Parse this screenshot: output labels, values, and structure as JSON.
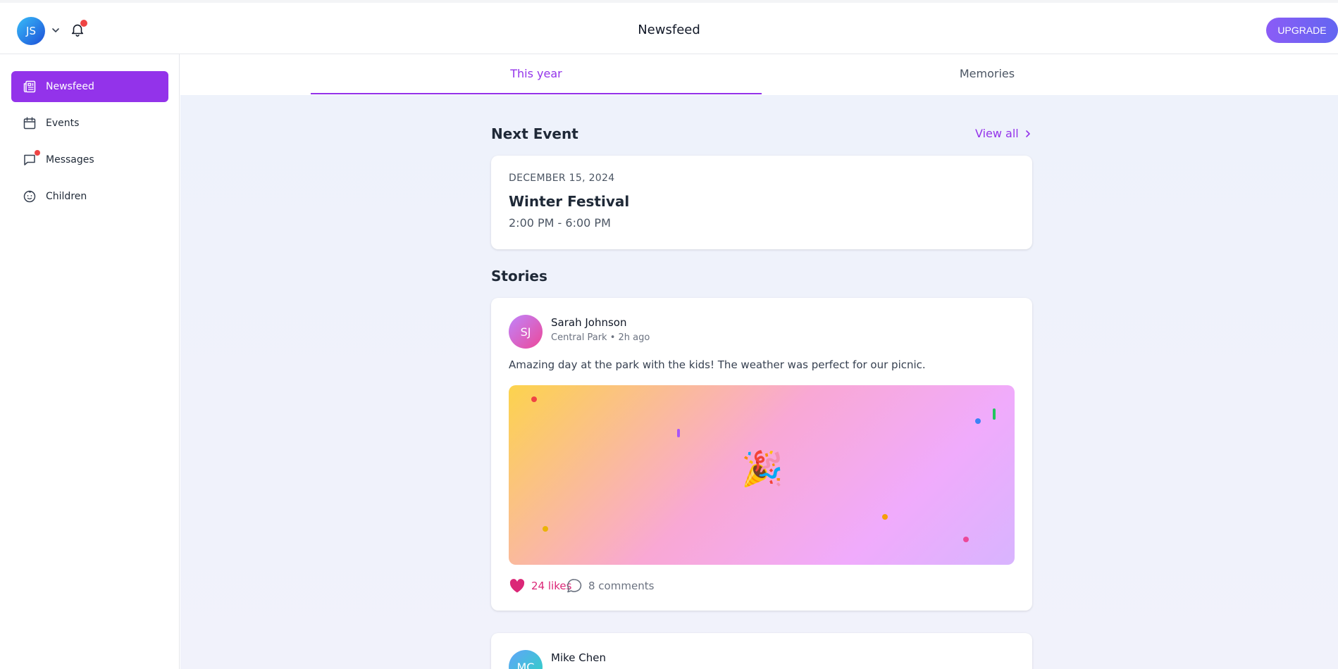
{
  "header": {
    "avatar_initials": "JS",
    "title": "Newsfeed",
    "upgrade_label": "UPGRADE"
  },
  "sidebar": {
    "items": [
      {
        "label": "Newsfeed",
        "icon": "newspaper-icon",
        "active": true
      },
      {
        "label": "Events",
        "icon": "calendar-icon"
      },
      {
        "label": "Messages",
        "icon": "chat-icon",
        "badge": true
      },
      {
        "label": "Children",
        "icon": "baby-icon"
      }
    ]
  },
  "tabs": [
    {
      "label": "This year",
      "active": true
    },
    {
      "label": "Memories"
    }
  ],
  "next_event": {
    "heading": "Next Event",
    "view_all": "View all",
    "date": "DECEMBER 15, 2024",
    "title": "Winter Festival",
    "time": "2:00 PM - 6:00 PM"
  },
  "stories": {
    "heading": "Stories",
    "items": [
      {
        "initials": "SJ",
        "name": "Sarah Johnson",
        "meta": "Central Park • 2h ago",
        "text": "Amazing day at the park with the kids! The weather was perfect for our picnic.",
        "image_emoji": "🎉",
        "likes": "24 likes",
        "comments": "8 comments"
      },
      {
        "initials": "MC",
        "name": "Mike Chen"
      }
    ]
  },
  "colors": {
    "accent": "#9333ea",
    "like": "#db2777",
    "notification": "#ef4444"
  }
}
